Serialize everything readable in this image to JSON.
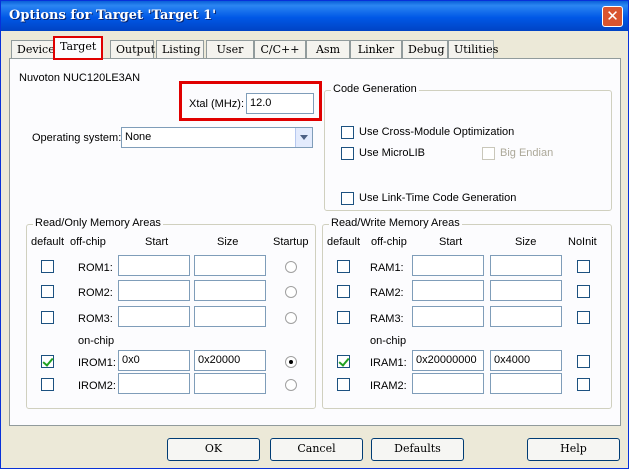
{
  "window": {
    "title": "Options for Target 'Target 1'",
    "close_glyph": "✕"
  },
  "tabs": [
    {
      "label": "Device"
    },
    {
      "label": "Target"
    },
    {
      "label": "Output"
    },
    {
      "label": "Listing"
    },
    {
      "label": "User"
    },
    {
      "label": "C/C++"
    },
    {
      "label": "Asm"
    },
    {
      "label": "Linker"
    },
    {
      "label": "Debug"
    },
    {
      "label": "Utilities"
    }
  ],
  "target": {
    "device_name": "Nuvoton NUC120LE3AN",
    "xtal_label": "Xtal (MHz):",
    "xtal_value": "12.0",
    "os_label": "Operating system:",
    "os_value": "None"
  },
  "code_generation": {
    "title": "Code Generation",
    "cross_module": "Use Cross-Module Optimization",
    "microlib": "Use MicroLIB",
    "big_endian": "Big Endian",
    "link_time": "Use Link-Time Code Generation"
  },
  "ro": {
    "title": "Read/Only Memory Areas",
    "headers": {
      "default": "default",
      "offchip": "off-chip",
      "start": "Start",
      "size": "Size",
      "startup": "Startup"
    },
    "onchip_label": "on-chip",
    "rows": [
      {
        "name": "ROM1:",
        "start": "",
        "size": ""
      },
      {
        "name": "ROM2:",
        "start": "",
        "size": ""
      },
      {
        "name": "ROM3:",
        "start": "",
        "size": ""
      },
      {
        "name": "IROM1:",
        "start": "0x0",
        "size": "0x20000"
      },
      {
        "name": "IROM2:",
        "start": "",
        "size": ""
      }
    ]
  },
  "rw": {
    "title": "Read/Write Memory Areas",
    "headers": {
      "default": "default",
      "offchip": "off-chip",
      "start": "Start",
      "size": "Size",
      "noinit": "NoInit"
    },
    "onchip_label": "on-chip",
    "rows": [
      {
        "name": "RAM1:",
        "start": "",
        "size": ""
      },
      {
        "name": "RAM2:",
        "start": "",
        "size": ""
      },
      {
        "name": "RAM3:",
        "start": "",
        "size": ""
      },
      {
        "name": "IRAM1:",
        "start": "0x20000000",
        "size": "0x4000"
      },
      {
        "name": "IRAM2:",
        "start": "",
        "size": ""
      }
    ]
  },
  "buttons": {
    "ok": "OK",
    "cancel": "Cancel",
    "defaults": "Defaults",
    "help": "Help"
  },
  "colors": {
    "title_bar": "#0058e6",
    "highlight": "#e00000",
    "dialog_bg": "#ece9d8"
  }
}
